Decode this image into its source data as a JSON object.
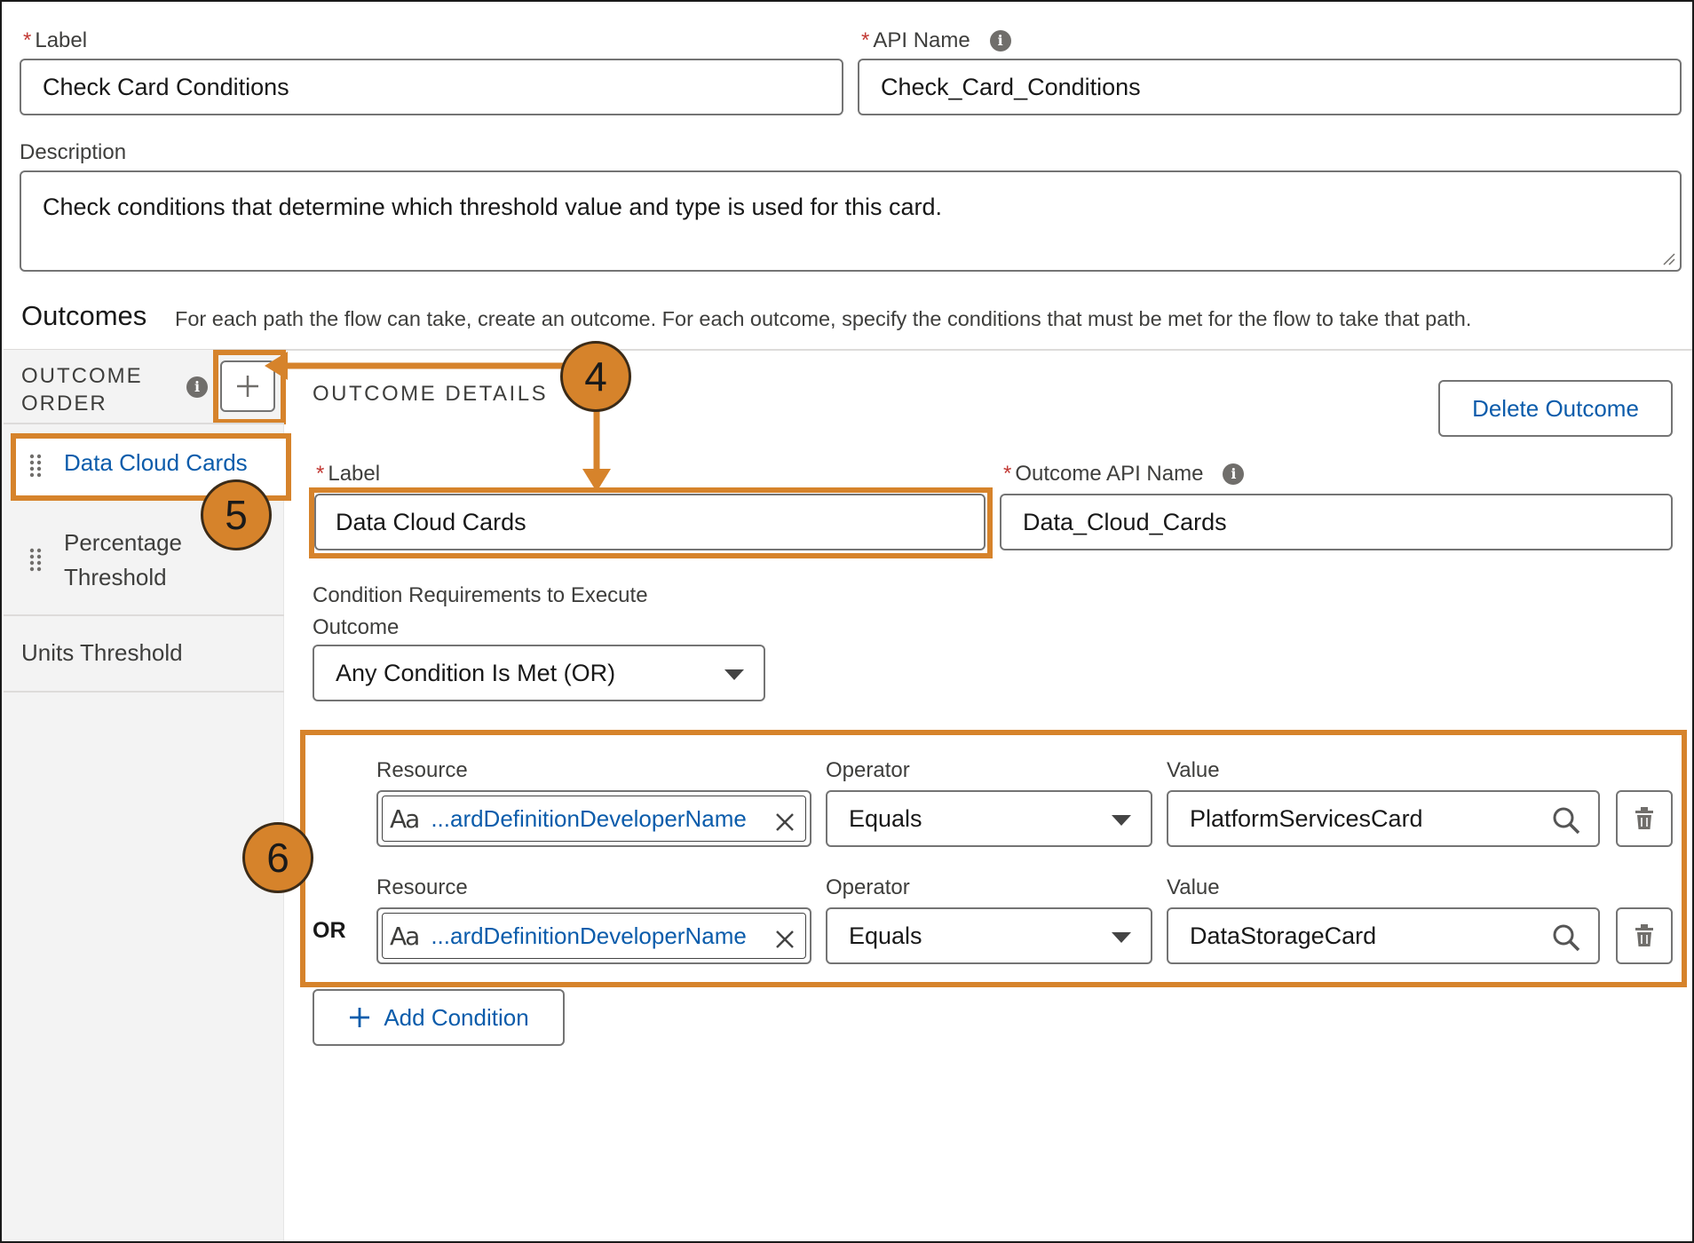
{
  "form": {
    "label_label": "Label",
    "label_value": "Check Card Conditions",
    "api_name_label": "API Name",
    "api_name_value": "Check_Card_Conditions",
    "description_label": "Description",
    "description_value": "Check conditions that determine which threshold value and type is used for this card."
  },
  "outcomes": {
    "title": "Outcomes",
    "help": "For each path the flow can take, create an outcome. For each outcome, specify the conditions that must be met for the flow to take that path.",
    "order_label_line1": "OUTCOME",
    "order_label_line2": "ORDER",
    "items": [
      {
        "label": "Data Cloud Cards"
      },
      {
        "label_line1": "Percentage",
        "label_line2": "Threshold"
      },
      {
        "label": "Units Threshold"
      }
    ]
  },
  "details": {
    "heading": "OUTCOME DETAILS",
    "delete_button": "Delete Outcome",
    "label_label": "Label",
    "label_value": "Data Cloud Cards",
    "api_label": "Outcome API Name",
    "api_value": "Data_Cloud_Cards",
    "req_label_line1": "Condition Requirements to Execute",
    "req_label_line2": "Outcome",
    "req_value": "Any Condition Is Met (OR)",
    "conditions": [
      {
        "resource_label": "Resource",
        "resource_icon": "Aa",
        "resource_value": "...ardDefinitionDeveloperName",
        "operator_label": "Operator",
        "operator_value": "Equals",
        "value_label": "Value",
        "value_value": "PlatformServicesCard"
      },
      {
        "prefix": "OR",
        "resource_label": "Resource",
        "resource_icon": "Aa",
        "resource_value": "...ardDefinitionDeveloperName",
        "operator_label": "Operator",
        "operator_value": "Equals",
        "value_label": "Value",
        "value_value": "DataStorageCard"
      }
    ],
    "add_condition": "Add Condition"
  },
  "callouts": {
    "c4": "4",
    "c5": "5",
    "c6": "6"
  },
  "colors": {
    "accent": "#d6832b",
    "link": "#0b5cab",
    "required": "#c23934"
  }
}
